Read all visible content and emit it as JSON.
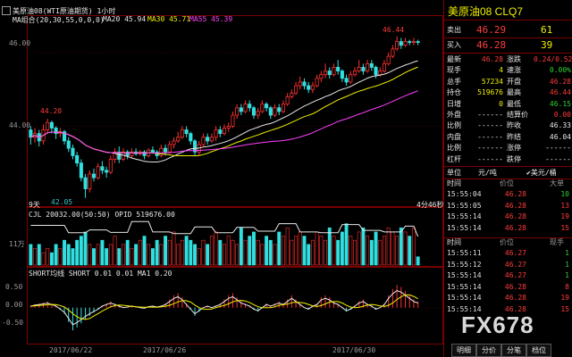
{
  "header": {
    "symbol": "美原油08(WTI原油期货) 1小时",
    "symbol_short": "美原油08",
    "ma_label": "MA组合(20,30,55,0,0,0)",
    "ma20": "MA20 45.94",
    "ma30": "MA30 45.71",
    "ma55": "MA55 45.39"
  },
  "price_axis": [
    "46.00",
    "44.00"
  ],
  "annotations": {
    "high_peak": "46.44",
    "high_left": "44.20",
    "low": "42.05",
    "left_label": "9天",
    "right_label": "4分46秒"
  },
  "volume": {
    "header": "CJL  20032.00(50:50)   OPID  519676.00",
    "axis": "11万"
  },
  "short_indicator": {
    "header": "SHORT均线  SHORT  0.01  0.01  MA1  0.20",
    "axis": [
      "0.50",
      "0.00",
      "-0.50"
    ]
  },
  "dates": [
    "2017/06/22",
    "2017/06/26",
    "2017/06/30"
  ],
  "quote": {
    "title": "美原油08  CLQ7",
    "ask_label": "卖出",
    "ask_price": "46.29",
    "ask_vol": "61",
    "bid_label": "买入",
    "bid_price": "46.28",
    "bid_vol": "39",
    "rows": [
      [
        "最新",
        "46.28",
        "涨跌",
        "0.24/0.52%"
      ],
      [
        "现手",
        "4",
        "速涨",
        "0.00%"
      ],
      [
        "总手",
        "57234",
        "开盘",
        "46.28"
      ],
      [
        "持仓",
        "519676",
        "最高",
        "46.44"
      ],
      [
        "日增",
        "0",
        "最低",
        "46.15"
      ],
      [
        "外盘",
        "------",
        "结算价",
        "0.00"
      ],
      [
        "比例",
        "------",
        "昨收",
        "46.33"
      ],
      [
        "内盘",
        "------",
        "昨结",
        "46.04"
      ],
      [
        "比例",
        "------",
        "涨停",
        "------"
      ],
      [
        "杠杆",
        "------",
        "跌停",
        "------"
      ]
    ],
    "unit_label": "单位",
    "unit_value": "元/吨",
    "currency": "✔美元/桶"
  },
  "ticks1": {
    "headers": [
      "时间",
      "价位",
      "大单"
    ],
    "rows": [
      [
        "15:55:04",
        "46.28",
        "10"
      ],
      [
        "15:55:05",
        "46.28",
        "13"
      ],
      [
        "15:55:14",
        "46.28",
        "19"
      ],
      [
        "15:55:14",
        "46.28",
        "15"
      ]
    ]
  },
  "ticks2": {
    "headers": [
      "时间",
      "价位",
      "现手"
    ],
    "rows": [
      [
        "15:55:11",
        "46.27",
        "1"
      ],
      [
        "15:55:12",
        "46.27",
        "1"
      ],
      [
        "15:55:14",
        "46.27",
        "1"
      ],
      [
        "15:55:14",
        "46.28",
        "8"
      ],
      [
        "15:55:14",
        "46.28",
        "19"
      ],
      [
        "15:55:14",
        "46.28",
        "15"
      ]
    ]
  },
  "tabs": [
    "明细",
    "分价",
    "分笔",
    "档位"
  ],
  "watermark": "FX678",
  "chart_data": {
    "type": "candlestick",
    "ylim": [
      41.9,
      46.75
    ],
    "candles": [
      [
        43.9,
        43.7,
        44.0,
        43.5
      ],
      [
        43.7,
        43.8,
        43.95,
        43.55
      ],
      [
        43.8,
        43.6,
        43.9,
        43.45
      ],
      [
        43.6,
        43.9,
        44.05,
        43.5
      ],
      [
        43.9,
        44.1,
        44.2,
        43.8
      ],
      [
        44.1,
        43.95,
        44.15,
        43.8
      ],
      [
        43.95,
        43.8,
        44.0,
        43.65
      ],
      [
        43.8,
        43.85,
        43.95,
        43.7
      ],
      [
        43.85,
        43.6,
        43.9,
        43.5
      ],
      [
        43.6,
        43.4,
        43.7,
        43.3
      ],
      [
        43.4,
        43.2,
        43.5,
        43.1
      ],
      [
        43.2,
        43.0,
        43.3,
        42.9
      ],
      [
        43.0,
        42.6,
        43.1,
        42.5
      ],
      [
        42.6,
        42.3,
        42.7,
        42.05
      ],
      [
        42.3,
        42.7,
        42.8,
        42.2
      ],
      [
        42.7,
        42.6,
        42.85,
        42.5
      ],
      [
        42.6,
        42.9,
        43.0,
        42.55
      ],
      [
        42.9,
        42.8,
        43.05,
        42.7
      ],
      [
        42.8,
        42.75,
        42.9,
        42.6
      ],
      [
        42.75,
        43.1,
        43.2,
        42.7
      ],
      [
        43.1,
        43.3,
        43.4,
        43.0
      ],
      [
        43.3,
        43.1,
        43.45,
        43.0
      ],
      [
        43.1,
        43.3,
        43.4,
        43.05
      ],
      [
        43.3,
        43.2,
        43.35,
        43.1
      ],
      [
        43.2,
        43.3,
        43.4,
        43.15
      ],
      [
        43.3,
        43.25,
        43.4,
        43.2
      ],
      [
        43.25,
        43.3,
        43.35,
        43.2
      ],
      [
        43.3,
        43.2,
        43.35,
        43.1
      ],
      [
        43.2,
        43.35,
        43.4,
        43.15
      ],
      [
        43.35,
        43.3,
        43.45,
        43.25
      ],
      [
        43.3,
        43.2,
        43.35,
        43.1
      ],
      [
        43.2,
        43.4,
        43.5,
        43.15
      ],
      [
        43.4,
        43.3,
        43.5,
        43.2
      ],
      [
        43.3,
        43.5,
        43.6,
        43.25
      ],
      [
        43.5,
        43.6,
        43.7,
        43.4
      ],
      [
        43.6,
        43.7,
        43.85,
        43.55
      ],
      [
        43.7,
        43.9,
        44.0,
        43.65
      ],
      [
        43.9,
        43.8,
        44.0,
        43.7
      ],
      [
        43.8,
        43.6,
        43.85,
        43.5
      ],
      [
        43.6,
        43.3,
        43.65,
        43.2
      ],
      [
        43.3,
        43.5,
        43.6,
        43.2
      ],
      [
        43.5,
        43.7,
        43.8,
        43.45
      ],
      [
        43.7,
        43.6,
        43.8,
        43.5
      ],
      [
        43.6,
        43.7,
        43.8,
        43.55
      ],
      [
        43.7,
        43.9,
        44.0,
        43.6
      ],
      [
        43.9,
        43.8,
        44.0,
        43.7
      ],
      [
        43.8,
        43.95,
        44.05,
        43.75
      ],
      [
        43.95,
        44.0,
        44.1,
        43.85
      ],
      [
        44.0,
        44.3,
        44.4,
        43.95
      ],
      [
        44.3,
        44.5,
        44.6,
        44.2
      ],
      [
        44.5,
        44.4,
        44.6,
        44.3
      ],
      [
        44.4,
        44.6,
        44.7,
        44.35
      ],
      [
        44.6,
        44.5,
        44.7,
        44.4
      ],
      [
        44.5,
        44.3,
        44.55,
        44.2
      ],
      [
        44.3,
        44.4,
        44.5,
        44.2
      ],
      [
        44.4,
        44.6,
        44.7,
        44.35
      ],
      [
        44.6,
        44.5,
        44.65,
        44.4
      ],
      [
        44.5,
        44.3,
        44.55,
        44.2
      ],
      [
        44.3,
        44.5,
        44.6,
        44.25
      ],
      [
        44.5,
        44.4,
        44.6,
        44.3
      ],
      [
        44.4,
        44.6,
        44.7,
        44.35
      ],
      [
        44.6,
        44.8,
        44.9,
        44.55
      ],
      [
        44.8,
        44.9,
        45.0,
        44.75
      ],
      [
        44.9,
        45.1,
        45.2,
        44.85
      ],
      [
        45.1,
        45.2,
        45.35,
        45.0
      ],
      [
        45.2,
        45.1,
        45.3,
        45.0
      ],
      [
        45.1,
        45.0,
        45.2,
        44.9
      ],
      [
        45.0,
        45.1,
        45.2,
        44.9
      ],
      [
        45.1,
        45.3,
        45.4,
        45.05
      ],
      [
        45.3,
        45.4,
        45.5,
        45.2
      ],
      [
        45.4,
        45.5,
        45.7,
        45.3
      ],
      [
        45.5,
        45.4,
        45.6,
        45.3
      ],
      [
        45.4,
        45.6,
        45.7,
        45.35
      ],
      [
        45.6,
        45.5,
        45.8,
        45.4
      ],
      [
        45.5,
        45.3,
        45.55,
        45.2
      ],
      [
        45.3,
        45.2,
        45.4,
        45.1
      ],
      [
        45.2,
        45.4,
        45.5,
        45.15
      ],
      [
        45.4,
        45.5,
        45.6,
        45.35
      ],
      [
        45.5,
        45.6,
        45.8,
        45.45
      ],
      [
        45.6,
        45.5,
        45.7,
        45.4
      ],
      [
        45.5,
        45.7,
        45.8,
        45.45
      ],
      [
        45.7,
        45.6,
        45.8,
        45.5
      ],
      [
        45.6,
        45.4,
        45.65,
        45.3
      ],
      [
        45.4,
        45.5,
        45.6,
        45.35
      ],
      [
        45.5,
        45.7,
        45.8,
        45.45
      ],
      [
        45.7,
        45.9,
        46.0,
        45.65
      ],
      [
        45.9,
        46.1,
        46.2,
        45.85
      ],
      [
        46.1,
        46.3,
        46.44,
        46.05
      ],
      [
        46.3,
        46.2,
        46.4,
        46.1
      ],
      [
        46.2,
        46.3,
        46.4,
        46.15
      ],
      [
        46.3,
        46.28,
        46.35,
        46.2
      ],
      [
        46.28,
        46.3,
        46.4,
        46.2
      ],
      [
        46.3,
        46.28,
        46.35,
        46.2
      ]
    ],
    "ma20_last": 45.94,
    "ma30_last": 45.71,
    "ma55_last": 45.39,
    "volume": [
      5,
      4,
      5,
      3,
      4,
      3,
      5,
      4,
      6,
      5,
      4,
      6,
      7,
      8,
      5,
      4,
      5,
      6,
      4,
      5,
      7,
      4,
      5,
      6,
      4,
      5,
      6,
      7,
      5,
      4,
      6,
      5,
      7,
      6,
      8,
      5,
      6,
      7,
      6,
      5,
      4,
      6,
      5,
      7,
      8,
      6,
      5,
      7,
      6,
      5,
      9,
      6,
      7,
      8,
      6,
      5,
      7,
      6,
      5,
      8,
      7,
      9,
      6,
      7,
      8,
      7,
      5,
      6,
      8,
      7,
      6,
      9,
      7,
      6,
      8,
      10,
      7,
      6,
      8,
      9,
      7,
      6,
      8,
      6,
      7,
      9,
      8,
      7,
      9,
      8,
      7,
      9,
      2
    ],
    "open_interest": [
      9.6,
      9.6,
      9.6,
      9.6,
      9.6,
      9.6,
      9.6,
      9.6,
      9.6,
      7.8,
      7.8,
      7.8,
      7.8,
      7.8,
      8.5,
      8.5,
      8.5,
      8.5,
      8.5,
      7.9,
      7.9,
      7.9,
      7.9,
      7.9,
      10.5,
      10.5,
      10.5,
      10.5,
      10.5,
      8.0,
      8.0,
      8.0,
      8.0,
      8.0,
      7.6,
      7.6,
      7.6,
      7.6,
      7.6,
      9.2,
      9.2,
      9.2,
      9.2,
      9.2,
      7.8,
      7.8,
      7.8,
      7.8,
      7.8,
      9.1,
      9.1,
      9.1,
      9.1,
      9.1,
      8.2,
      8.2,
      8.2,
      8.2,
      8.2,
      10.0,
      10.0,
      10.0,
      10.0,
      10.0,
      8.0,
      8.0,
      8.0,
      8.0,
      8.0,
      7.8,
      7.8,
      7.8,
      7.8,
      7.8,
      9.8,
      9.8,
      9.8,
      9.8,
      9.8,
      8.4,
      8.4,
      8.4,
      8.4,
      8.4,
      8.0,
      8.0,
      8.0,
      8.0,
      8.0,
      9.4,
      9.4,
      9.4,
      6.9
    ],
    "vol_max": 11,
    "short": [
      0.05,
      0.08,
      0.1,
      0.12,
      0.15,
      0.1,
      0.05,
      -0.05,
      -0.15,
      -0.35,
      -0.55,
      -0.48,
      -0.38,
      -0.28,
      -0.2,
      -0.12,
      -0.05,
      0.05,
      0.1,
      0.15,
      0.1,
      0.05,
      0.0,
      0.02,
      0.05,
      0.03,
      0.0,
      -0.02,
      0.03,
      0.05,
      0.02,
      0.05,
      0.1,
      0.2,
      0.3,
      0.35,
      0.25,
      0.1,
      -0.05,
      -0.2,
      -0.1,
      0.0,
      0.05,
      0.0,
      0.05,
      0.1,
      0.2,
      0.3,
      0.35,
      0.25,
      0.15,
      0.1,
      0.05,
      -0.05,
      -0.1,
      0.0,
      0.1,
      0.05,
      0.1,
      0.15,
      0.1,
      0.2,
      0.3,
      0.2,
      0.1,
      0.0,
      -0.05,
      0.05,
      0.1,
      0.25,
      0.3,
      0.25,
      0.15,
      0.1,
      0.0,
      -0.1,
      -0.05,
      0.05,
      0.15,
      0.2,
      0.1,
      0.05,
      -0.05,
      0.0,
      0.1,
      0.3,
      0.45,
      0.55,
      0.5,
      0.4,
      0.3,
      0.2,
      0.15
    ],
    "short_ylim": [
      -0.85,
      0.75
    ]
  }
}
